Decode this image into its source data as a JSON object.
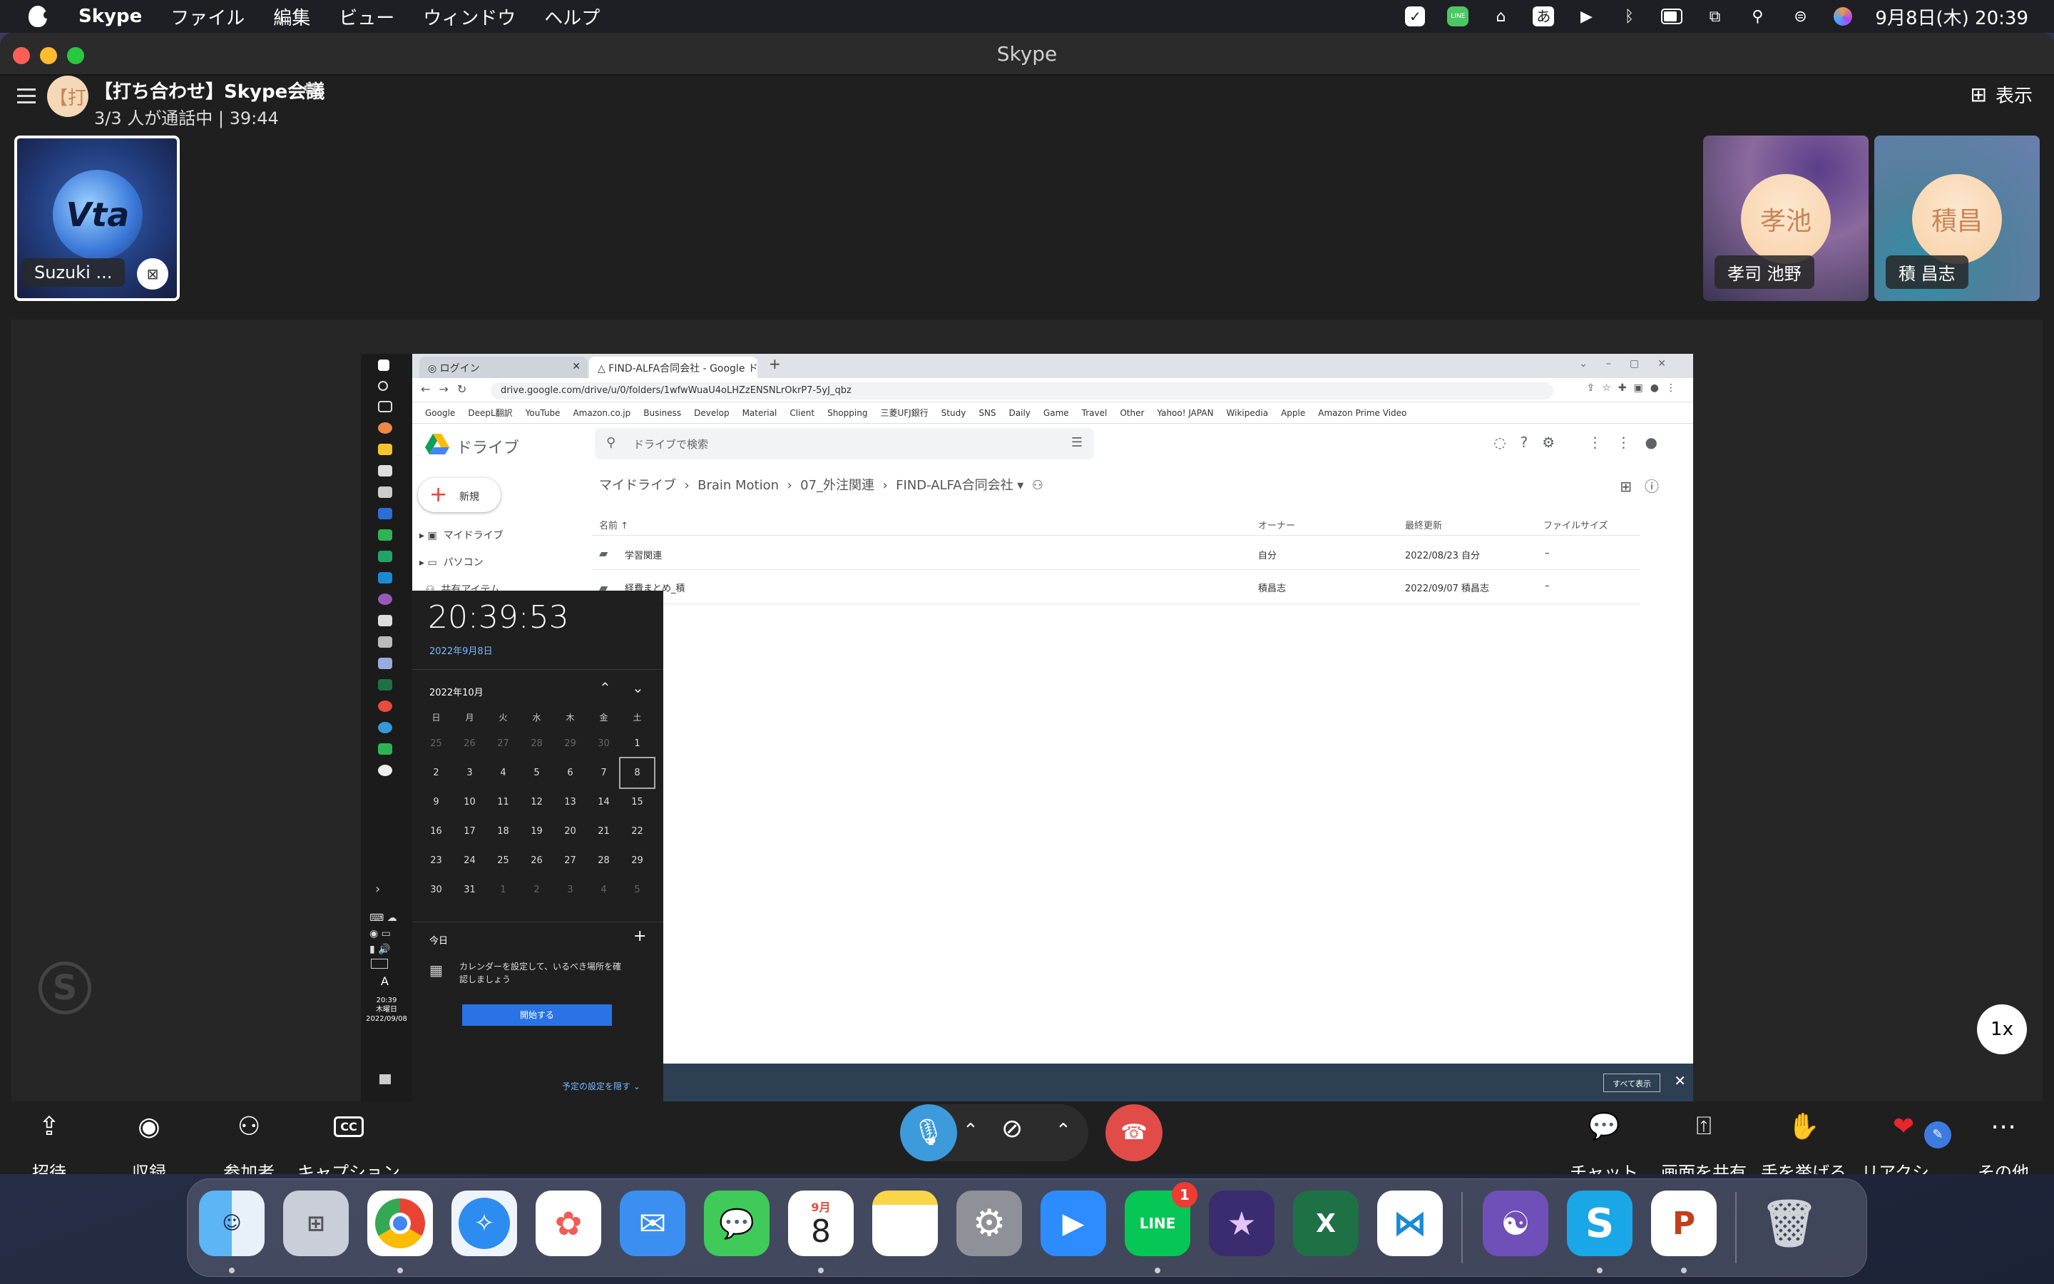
{
  "menubar": {
    "app_name": "Skype",
    "items": [
      "ファイル",
      "編集",
      "ビュー",
      "ウィンドウ",
      "ヘルプ"
    ],
    "ime": "あ",
    "line_label": "LINE",
    "datetime": "9月8日(木) 20:39"
  },
  "window": {
    "title": "Skype"
  },
  "call": {
    "title": "【打ち合わせ】Skype会議",
    "avatar_text": "【打",
    "status": "3/3 人が通話中 | 39:44",
    "view_label": "表示"
  },
  "participants": {
    "self": {
      "label": "Suzuki ...",
      "logo": "Vta"
    },
    "others": [
      {
        "initials": "孝池",
        "name": "孝司 池野"
      },
      {
        "initials": "積昌",
        "name": "積 昌志"
      }
    ]
  },
  "screen_share": {
    "tabs": [
      "ログイン",
      "FIND-ALFA合同会社 - Google ドライブ"
    ],
    "url": "drive.google.com/drive/u/0/folders/1wfwWuaU4oLHZzENSNLrOkrP7-5yJ_qbz",
    "bookmarks": [
      "Google",
      "DeepL翻訳",
      "YouTube",
      "Amazon.co.jp",
      "Business",
      "Develop",
      "Material",
      "Client",
      "Shopping",
      "三菱UFJ銀行",
      "Study",
      "SNS",
      "Daily",
      "Game",
      "Travel",
      "Other",
      "Yahoo! JAPAN",
      "Wikipedia",
      "Apple",
      "Amazon Prime Video"
    ],
    "drive": {
      "app_label": "ドライブ",
      "search_placeholder": "ドライブで検索",
      "new_label": "新規",
      "nav": [
        "マイドライブ",
        "パソコン",
        "共有アイテム"
      ],
      "breadcrumb": [
        "マイドライブ",
        "Brain Motion",
        "07_外注関連",
        "FIND-ALFA合同会社"
      ],
      "columns": [
        "名前 ↑",
        "オーナー",
        "最終更新",
        "ファイルサイズ"
      ],
      "rows": [
        {
          "name": "学習関連",
          "owner": "自分",
          "modified": "2022/08/23 自分",
          "size": "–"
        },
        {
          "name": "経費まとめ_積",
          "owner": "積昌志",
          "modified": "2022/09/07 積昌志",
          "size": "–"
        }
      ]
    },
    "clock": {
      "time": "20:39:53",
      "date": "2022年9月8日",
      "month": "2022年10月",
      "weekdays": [
        "日",
        "月",
        "火",
        "水",
        "木",
        "金",
        "土"
      ],
      "weeks": [
        [
          "25",
          "26",
          "27",
          "28",
          "29",
          "30",
          "1"
        ],
        [
          "2",
          "3",
          "4",
          "5",
          "6",
          "7",
          "8"
        ],
        [
          "9",
          "10",
          "11",
          "12",
          "13",
          "14",
          "15"
        ],
        [
          "16",
          "17",
          "18",
          "19",
          "20",
          "21",
          "22"
        ],
        [
          "23",
          "24",
          "25",
          "26",
          "27",
          "28",
          "29"
        ],
        [
          "30",
          "31",
          "1",
          "2",
          "3",
          "4",
          "5"
        ]
      ],
      "today_label": "今日",
      "setup_text_1": "カレンダーを設定して、いるべき場所を確",
      "setup_text_2": "認しましょう",
      "start_button": "開始する",
      "hide_link": "予定の設定を隠す"
    },
    "taskbar_clock": {
      "time": "20:39",
      "day": "木曜日",
      "date": "2022/09/08"
    },
    "ime_letter": "A",
    "show_all": "すべて表示"
  },
  "zoom": "1x",
  "controls": {
    "left": [
      "招待",
      "収録",
      "参加者",
      "キャプション"
    ],
    "right": [
      "チャット",
      "画面を共有",
      "手を挙げる",
      "リアクシ...",
      "その他"
    ]
  },
  "dock": {
    "calendar_month": "9月",
    "calendar_day": "8",
    "line_badge": "1",
    "line_label": "LINE"
  }
}
